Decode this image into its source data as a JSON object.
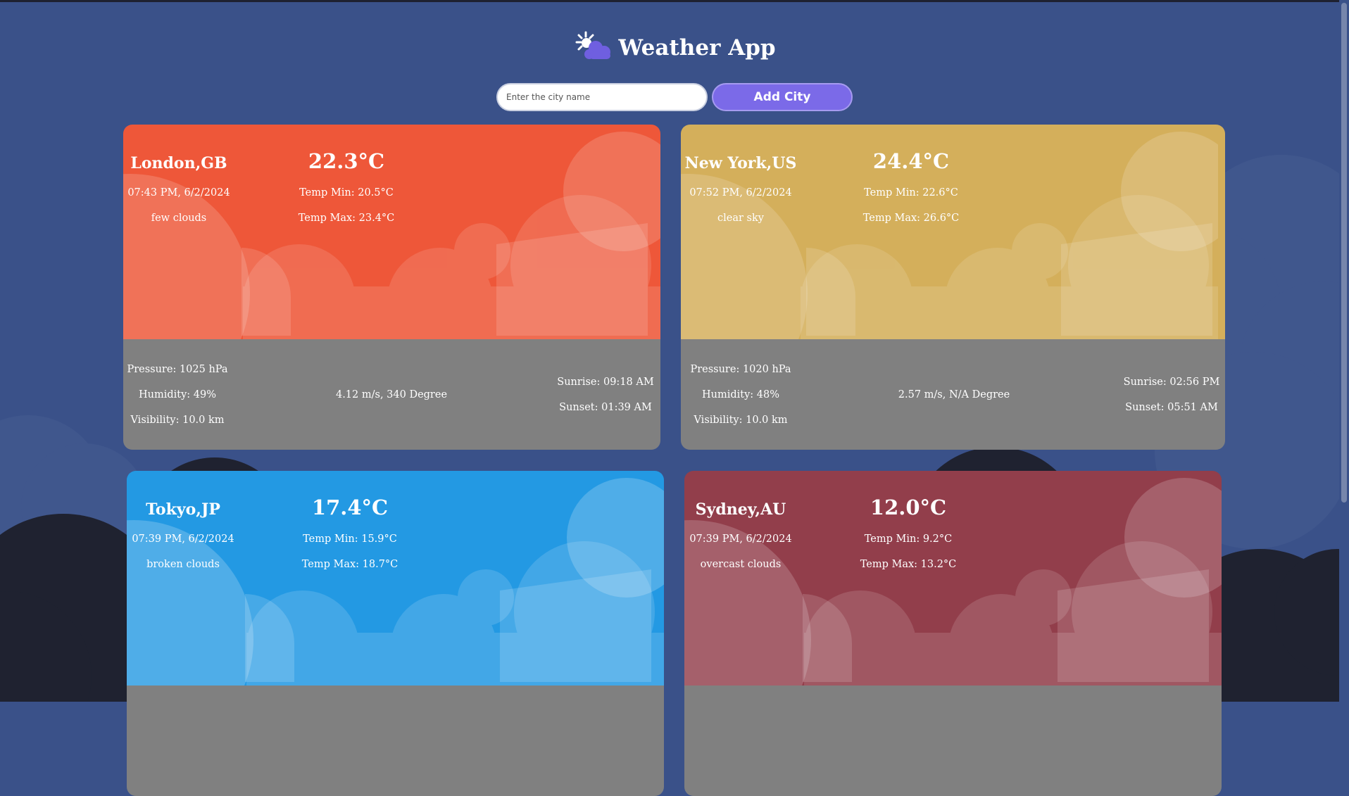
{
  "app": {
    "title": "Weather App",
    "logo_icon": "sun-cloud-icon"
  },
  "search": {
    "placeholder": "Enter the city name",
    "value": "",
    "button_label": "Add City"
  },
  "colors": {
    "background": "#3a5189",
    "button": "#7b6ae8",
    "details_panel": "#808080",
    "london": "#ee5739",
    "new_york": "#d4af5b",
    "tokyo": "#2399e3",
    "sydney": "#923e4b"
  },
  "cards": [
    {
      "city": "London,GB",
      "datetime": "07:43 PM, 6/2/2024",
      "description": "few clouds",
      "temp": "22.3°C",
      "temp_min": "Temp Min: 20.5°C",
      "temp_max": "Temp Max: 23.4°C",
      "pressure": "Pressure: 1025 hPa",
      "humidity": "Humidity: 49%",
      "visibility": "Visibility: 10.0 km",
      "wind": "4.12 m/s, 340 Degree",
      "sunrise": "Sunrise: 09:18 AM",
      "sunset": "Sunset: 01:39 AM"
    },
    {
      "city": "New York,US",
      "datetime": "07:52 PM, 6/2/2024",
      "description": "clear sky",
      "temp": "24.4°C",
      "temp_min": "Temp Min: 22.6°C",
      "temp_max": "Temp Max: 26.6°C",
      "pressure": "Pressure: 1020 hPa",
      "humidity": "Humidity: 48%",
      "visibility": "Visibility: 10.0 km",
      "wind": "2.57 m/s, N/A Degree",
      "sunrise": "Sunrise: 02:56 PM",
      "sunset": "Sunset: 05:51 AM"
    },
    {
      "city": "Tokyo,JP",
      "datetime": "07:39 PM, 6/2/2024",
      "description": "broken clouds",
      "temp": "17.4°C",
      "temp_min": "Temp Min: 15.9°C",
      "temp_max": "Temp Max: 18.7°C"
    },
    {
      "city": "Sydney,AU",
      "datetime": "07:39 PM, 6/2/2024",
      "description": "overcast clouds",
      "temp": "12.0°C",
      "temp_min": "Temp Min: 9.2°C",
      "temp_max": "Temp Max: 13.2°C"
    }
  ]
}
